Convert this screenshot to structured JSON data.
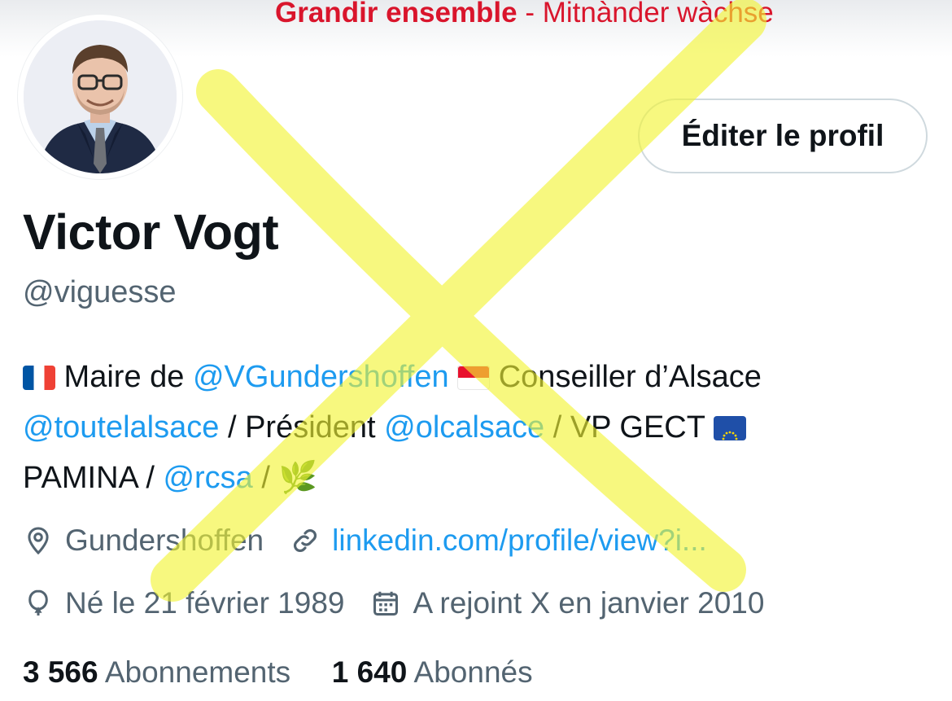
{
  "banner": {
    "title_bold": "Grandir ensemble",
    "title_rest": " - Mitnànder wàchse",
    "color": "#d9152c"
  },
  "profile": {
    "name": "Victor Vogt",
    "handle": "@viguesse",
    "edit_label": "Éditer le profil",
    "avatar_icon": "profile-photo"
  },
  "bio": {
    "line1": {
      "t1": " Maire de ",
      "link1": "@VGundershoffen",
      "t2": " ",
      "t3": " Conseiller d’Alsace"
    },
    "line2": {
      "link1": "@toutelalsace",
      "t1": " / Président ",
      "link2": "@olcalsace",
      "t2": " / VP GECT "
    },
    "line3": {
      "t1": "PAMINA / ",
      "link1": "@rcsa",
      "t2": " / ",
      "emoji": "🌿"
    }
  },
  "meta": {
    "location": "Gundershoffen",
    "website": "linkedin.com/profile/view?i...",
    "birth": "Né le 21 février 1989",
    "joined": "A rejoint X en janvier 2010"
  },
  "stats": {
    "following_count": "3 566",
    "following_label": " Abonnements",
    "followers_count": "1 640",
    "followers_label": " Abonnés"
  },
  "colors": {
    "link": "#1d9bf0",
    "secondary": "#536471",
    "text": "#0f1419",
    "overlay": "#f5f53d"
  }
}
